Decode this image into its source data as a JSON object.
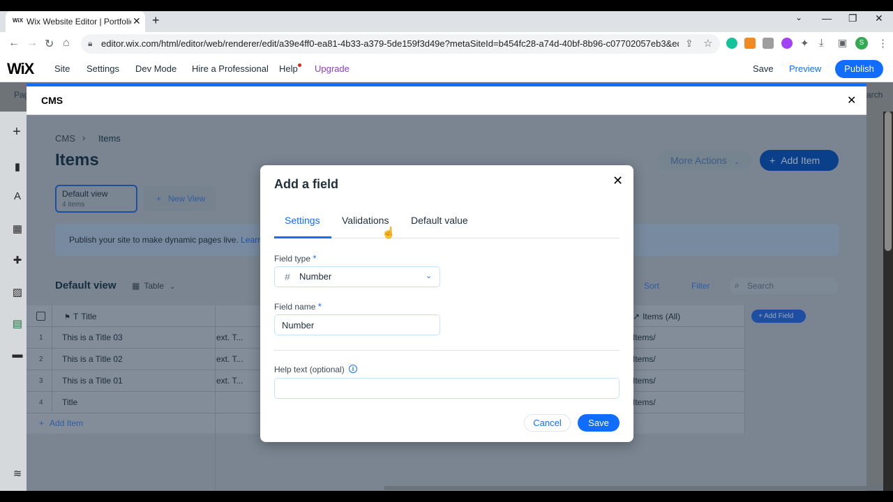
{
  "browser": {
    "tab_title": "Wix Website Editor | Portfolio Ba",
    "favicon_text": "WiX",
    "url": "editor.wix.com/html/editor/web/renderer/edit/a39e4ff0-ea81-4b33-a379-5de159f3d49e?metaSiteId=b454fc28-a74d-40bf-8b96-c07702057eb3&editorSessionI...",
    "profile_initial": "S"
  },
  "wix_bar": {
    "logo": "WiX",
    "menu": [
      "Site",
      "Settings",
      "Dev Mode",
      "Hire a Professional",
      "Help",
      "Upgrade"
    ],
    "save": "Save",
    "preview": "Preview",
    "publish": "Publish",
    "partial_left": "Pag",
    "partial_right": "arch"
  },
  "cms": {
    "title": "CMS",
    "breadcrumb": [
      "CMS",
      "Items"
    ],
    "page_title": "Items",
    "more_actions": "More Actions",
    "add_item": "Add Item",
    "view": {
      "name": "Default view",
      "count": "4 items"
    },
    "new_view": "New View",
    "publish_banner": "Publish your site to make dynamic pages live. ",
    "publish_link": "Learr",
    "grid_title": "Default view",
    "table_selector": "Table",
    "sort": "Sort",
    "filter": "Filter",
    "search_placeholder": "Search",
    "columns": {
      "title": "Title",
      "items": "Items (All)"
    },
    "add_field": "Add Field",
    "rows": [
      {
        "num": "1",
        "title": "This is a Title 03",
        "ext": "ext. T...",
        "items": "Items/"
      },
      {
        "num": "2",
        "title": "This is a Title 02",
        "ext": "ext. T...",
        "items": "Items/"
      },
      {
        "num": "3",
        "title": "This is a Title 01",
        "ext": "ext. T...",
        "items": "Items/"
      },
      {
        "num": "4",
        "title": "Title",
        "ext": "",
        "items": "Items/"
      }
    ],
    "add_item_row": "Add Item"
  },
  "dialog": {
    "title": "Add a field",
    "tabs": [
      "Settings",
      "Validations",
      "Default value"
    ],
    "active_tab": "Settings",
    "field_type_label": "Field type",
    "field_type_value": "Number",
    "field_name_label": "Field name",
    "field_name_value": "Number",
    "help_text_label": "Help text (optional)",
    "help_text_value": "",
    "required_mark": "*",
    "cancel": "Cancel",
    "save": "Save"
  },
  "colors": {
    "accent": "#116dff",
    "text": "#20303c"
  }
}
